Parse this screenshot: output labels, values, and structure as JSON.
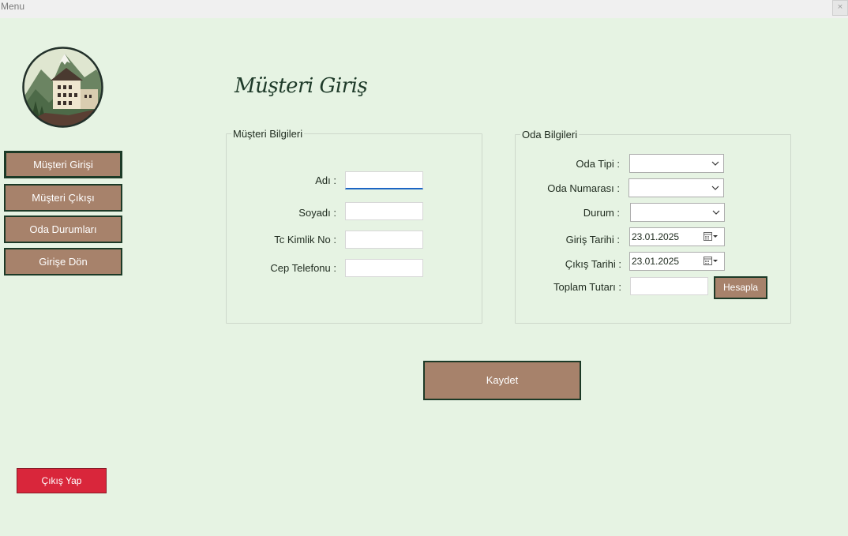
{
  "window": {
    "title": "Menu",
    "close_label": "×"
  },
  "logo": {
    "icon": "mountain-hotel-logo"
  },
  "sidebar": {
    "items": [
      {
        "label": "Müşteri Girişi",
        "active": true
      },
      {
        "label": "Müşteri Çıkışı",
        "active": false
      },
      {
        "label": "Oda Durumları",
        "active": false
      },
      {
        "label": "Girişe Dön",
        "active": false
      }
    ],
    "exit_label": "Çıkış Yap"
  },
  "page": {
    "title": "Müşteri Giriş"
  },
  "customer_group": {
    "legend": "Müşteri Bilgileri",
    "fields": {
      "name": {
        "label": "Adı :",
        "value": ""
      },
      "surname": {
        "label": "Soyadı :",
        "value": ""
      },
      "tc": {
        "label": "Tc Kimlik No :",
        "value": ""
      },
      "phone": {
        "label": "Cep Telefonu :",
        "value": ""
      }
    }
  },
  "room_group": {
    "legend": "Oda Bilgileri",
    "fields": {
      "room_type": {
        "label": "Oda Tipi :",
        "value": ""
      },
      "room_number": {
        "label": "Oda Numarası :",
        "value": ""
      },
      "status": {
        "label": "Durum :",
        "value": ""
      },
      "checkin_date": {
        "label": "Giriş Tarihi :",
        "value": "23.01.2025"
      },
      "checkout_date": {
        "label": "Çıkış Tarihi :",
        "value": "23.01.2025"
      },
      "total": {
        "label": "Toplam Tutarı :",
        "value": ""
      }
    },
    "calculate_label": "Hesapla"
  },
  "save_label": "Kaydet",
  "colors": {
    "background": "#e6f3e3",
    "button": "#a7826b",
    "button_border": "#1c3a27",
    "exit_button": "#d9263b",
    "focus_accent": "#1b65c4"
  }
}
